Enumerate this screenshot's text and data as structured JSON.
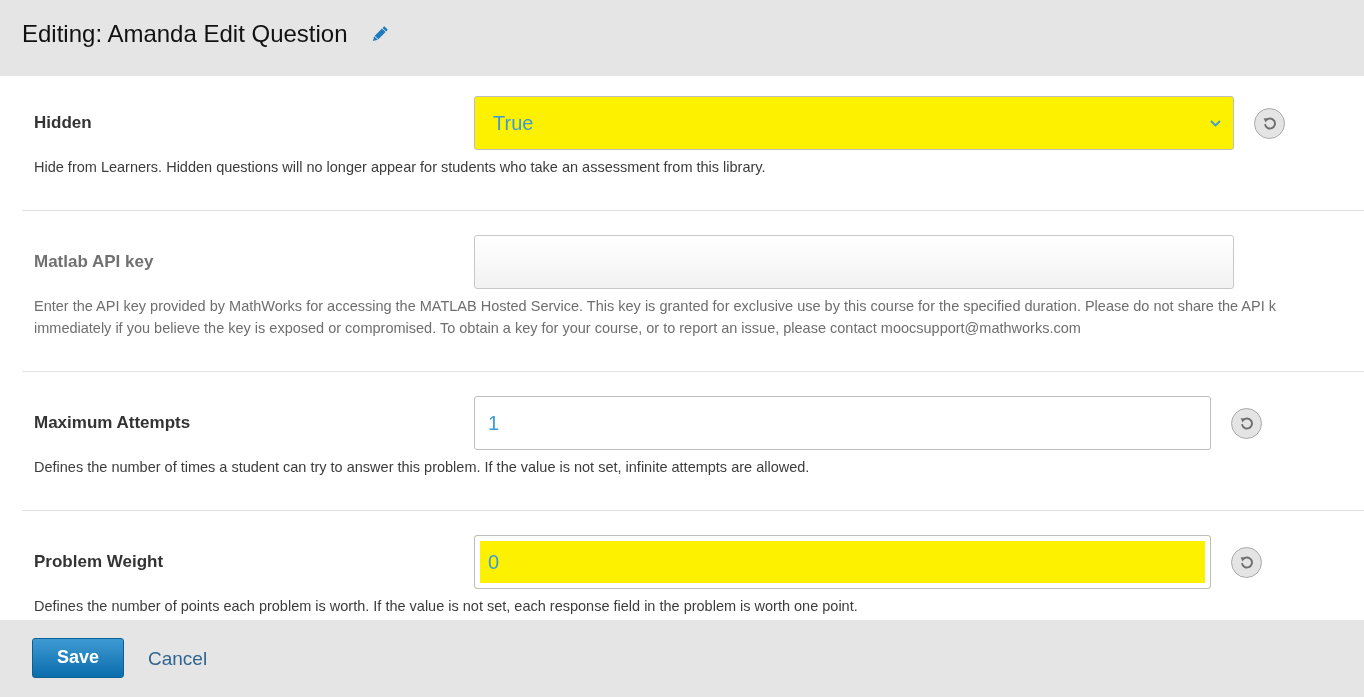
{
  "header": {
    "title": "Editing: Amanda Edit Question"
  },
  "settings": [
    {
      "label": "Hidden",
      "kind": "select",
      "value": "True",
      "is_set": true,
      "highlighted": true,
      "help": [
        "Hide from Learners. Hidden questions will no longer appear for students who take an assessment from this library."
      ]
    },
    {
      "label": "Matlab API key",
      "kind": "text",
      "is_set": false,
      "highlighted": false,
      "help": [
        "Enter the API key provided by MathWorks for accessing the MATLAB Hosted Service. This key is granted for exclusive use by this course for the specified duration. Please do not share the API k",
        "immediately if you believe the key is exposed or compromised. To obtain a key for your course, or to report an issue, please contact moocsupport@mathworks.com"
      ]
    },
    {
      "label": "Maximum Attempts",
      "kind": "text",
      "value": "1",
      "is_set": true,
      "highlighted": false,
      "help": [
        "Defines the number of times a student can try to answer this problem. If the value is not set, infinite attempts are allowed."
      ]
    },
    {
      "label": "Problem Weight",
      "kind": "text",
      "value": "0",
      "is_set": true,
      "highlighted": true,
      "help": [
        "Defines the number of points each problem is worth. If the value is not set, each response field in the problem is worth one point."
      ]
    }
  ],
  "footer": {
    "save": "Save",
    "cancel": "Cancel"
  }
}
